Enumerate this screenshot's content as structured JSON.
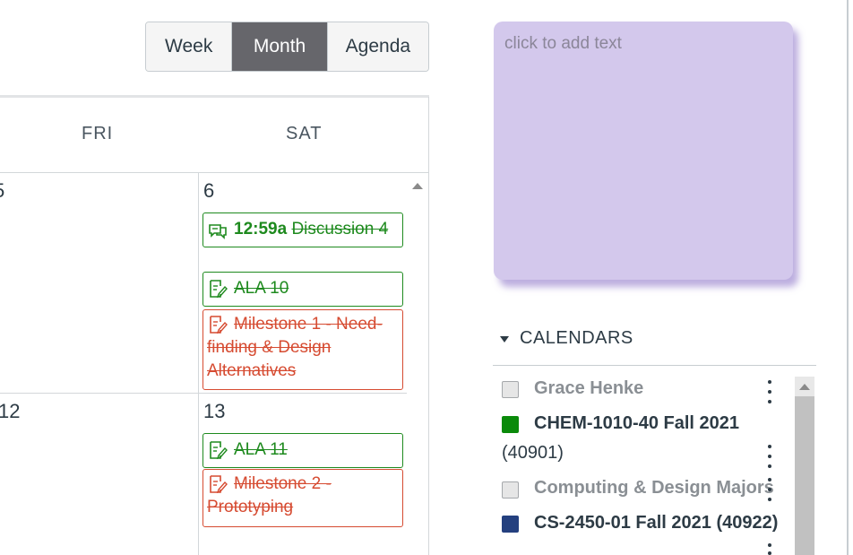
{
  "view_toggle": {
    "week": "Week",
    "month": "Month",
    "agenda": "Agenda",
    "active": "Month"
  },
  "calendar_grid": {
    "headers": [
      "FRI",
      "SAT"
    ],
    "dates": {
      "fri_week1": "5",
      "sat_week1": "6",
      "fri_week2": "12",
      "sat_week2": "13"
    },
    "events": {
      "discussion4": {
        "time": "12:59a",
        "title": "Discussion 4",
        "icon": "discussion-icon",
        "color": "#1e8a1e",
        "completed": true
      },
      "ala10": {
        "title": "ALA 10",
        "icon": "assignment-icon",
        "color": "#1e8a1e",
        "completed": true
      },
      "milestone1": {
        "title": "Milestone 1 - Need-finding & Design Alternatives",
        "icon": "assignment-icon",
        "color": "#d64b31",
        "completed": true
      },
      "ala11": {
        "title": "ALA 11",
        "icon": "assignment-icon",
        "color": "#1e8a1e",
        "completed": true
      },
      "milestone2": {
        "title": "Milestone 2 - Prototyping",
        "icon": "assignment-icon",
        "color": "#d64b31",
        "completed": true
      }
    }
  },
  "note": {
    "placeholder": "click to add text",
    "color": "#d3c8ec"
  },
  "calendars": {
    "heading": "CALENDARS",
    "items": [
      {
        "label": "Grace Henke",
        "checked": false,
        "color": "#e6e6e6"
      },
      {
        "label_line1": "CHEM-1010-40 Fall 2021",
        "label_line2": "(40901)",
        "checked": true,
        "color": "#0a8a0a"
      },
      {
        "label": "Computing & Design Majors",
        "checked": false,
        "color": "#e6e6e6"
      },
      {
        "label": "CS-2450-01 Fall 2021 (40922)",
        "checked": true,
        "color": "#24407f"
      }
    ]
  }
}
